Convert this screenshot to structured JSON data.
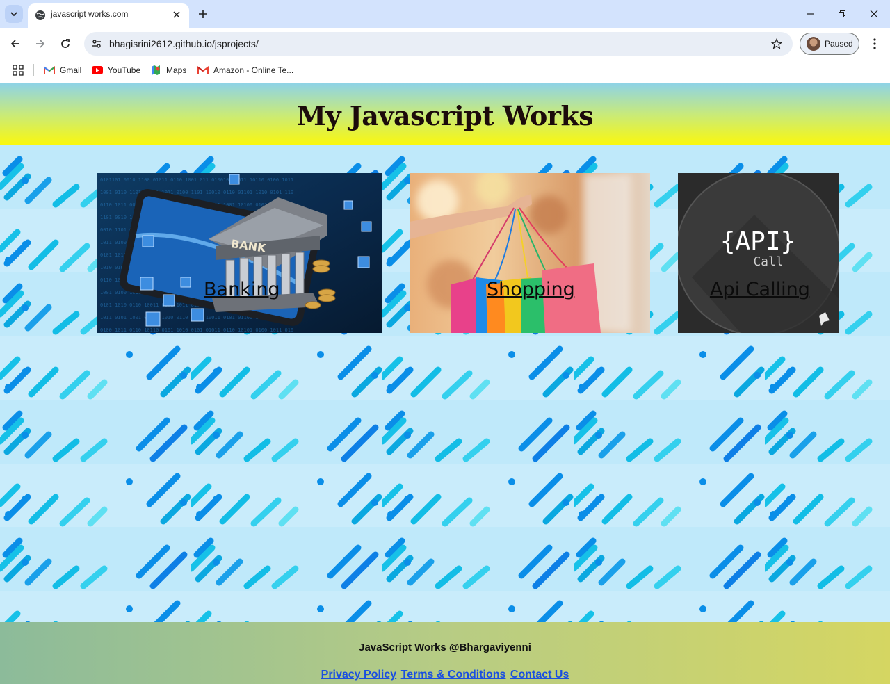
{
  "browser": {
    "tab_title": "javascript works.com",
    "url": "bhagisrini2612.github.io/jsprojects/",
    "profile_label": "Paused",
    "bookmarks": [
      {
        "label": "Gmail",
        "icon": "gmail-icon"
      },
      {
        "label": "YouTube",
        "icon": "youtube-icon"
      },
      {
        "label": "Maps",
        "icon": "maps-icon"
      },
      {
        "label": "Amazon - Online Te...",
        "icon": "amazon-icon"
      }
    ]
  },
  "site": {
    "title": "My Javascript Works",
    "cards": [
      {
        "label": "Banking",
        "image": "bank-image"
      },
      {
        "label": "Shopping",
        "image": "shopping-bags-image"
      },
      {
        "label": "Api Calling",
        "image": "api-call-image",
        "image_text": "{API}",
        "image_subtext": "Call"
      }
    ],
    "footer": {
      "credit": "JavaScript Works @Bhargaviyenni",
      "links": [
        "Privacy Policy",
        "Terms & Conditions",
        "Contact Us"
      ]
    }
  },
  "colors": {
    "header_gradient_top": "#8ed3e6",
    "header_gradient_bottom": "#fbf80c",
    "pattern_bg": "#c9ecfb",
    "pattern_accent": "#0a8ee8",
    "footer_link": "#1a4fe0"
  }
}
